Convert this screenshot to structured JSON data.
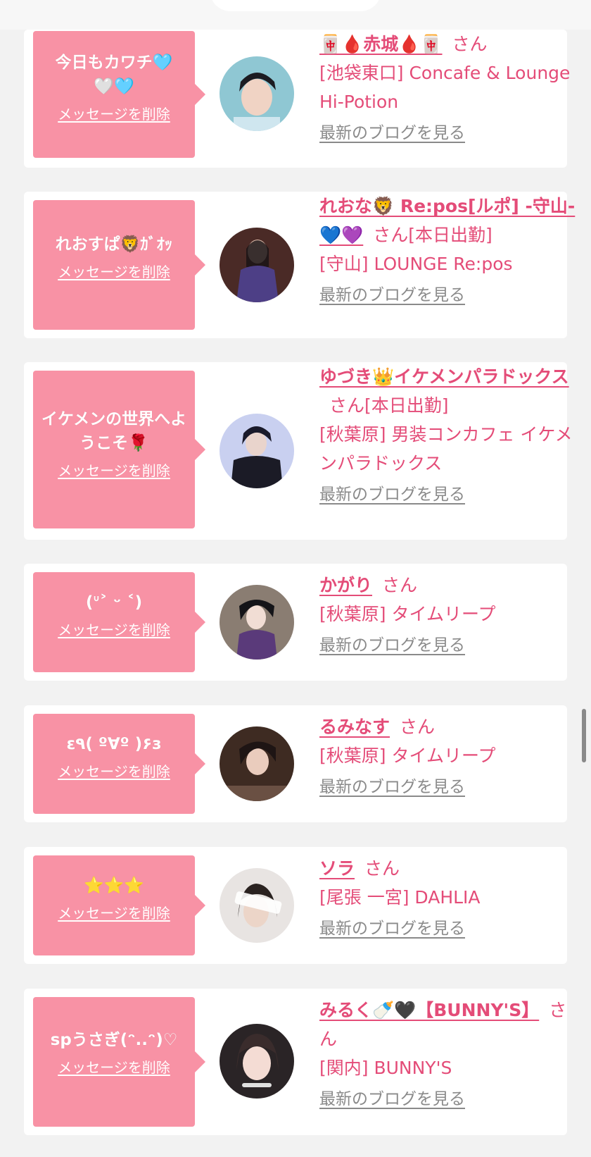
{
  "colors": {
    "bubble": "#f892a5",
    "accent": "#e44c78",
    "link_gray": "#8a8a8a"
  },
  "delete_label": "メッセージを削除",
  "blog_label": "最新のブログを見る",
  "items": [
    {
      "message": "今日もカワチ🩵🤍🩵",
      "name": "🀄🩸赤城🩸🀄",
      "suffix": "さん",
      "shop": "[池袋東口] Concafe & Lounge Hi-Potion"
    },
    {
      "message": "れおすぱ🦁ｶﾞｵｯ",
      "name": "れおな🦁 Re:pos[ルポ] -守山-💙💜",
      "suffix": "さん[本日出勤]",
      "shop": "[守山] LOUNGE Re:pos"
    },
    {
      "message": "イケメンの世界へようこそ🌹",
      "name": "ゆづき👑イケメンパラドックス",
      "suffix": "さん[本日出勤]",
      "shop": "[秋葉原] 男装コンカフェ イケメンパラドックス"
    },
    {
      "message": "(ᐡ˃ ᵕ ˂)",
      "name": "かがり",
      "suffix": "さん",
      "shop": "[秋葉原] タイムリープ"
    },
    {
      "message": "ε٩( º∀º )۶з",
      "name": "るみなす",
      "suffix": "さん",
      "shop": "[秋葉原] タイムリープ"
    },
    {
      "message": "⭐⭐⭐",
      "name": "ソラ",
      "suffix": "さん",
      "shop": "[尾張 一宮] DAHLIA"
    },
    {
      "message": "spうさぎ(ᵔ..ᵔ)♡",
      "name": "みるく🍼🖤【BUNNY'S】",
      "suffix": "さん",
      "shop": "[関内] BUNNY'S"
    }
  ]
}
